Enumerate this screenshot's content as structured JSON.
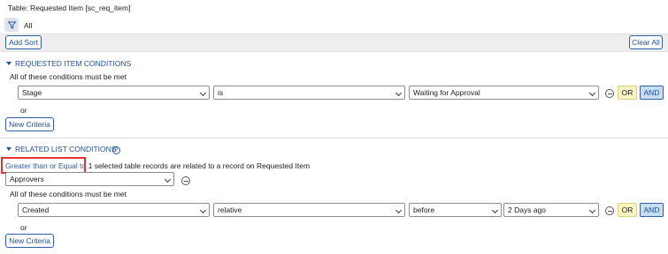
{
  "header": {
    "title": "Table: Requested Item [sc_req_item]",
    "breadcrumb": "All"
  },
  "sortbar": {
    "add_sort": "Add Sort",
    "clear_all": "Clear All"
  },
  "requested_item": {
    "heading": "REQUESTED ITEM CONDITIONS",
    "note": "All of these conditions must be met",
    "condition": {
      "field": "Stage",
      "operator": "is",
      "value": "Waiting for Approval"
    },
    "or_label": "OR",
    "and_label": "AND",
    "or_separator": "or",
    "new_criteria": "New Criteria"
  },
  "related_list": {
    "heading": "RELATED LIST CONDITIONS",
    "help": "?",
    "quantifier_link": "Greater than or Equal to",
    "quantifier_value": "1",
    "sentence": "selected table records are related to a record on Requested Item",
    "list_select": "Approvers",
    "note": "All of these conditions must be met",
    "condition": {
      "field": "Created",
      "operator": "relative",
      "direction": "before",
      "value": "2 Days ago"
    },
    "or_label": "OR",
    "and_label": "AND",
    "or_separator": "or",
    "new_criteria": "New Criteria"
  },
  "colors": {
    "accent": "#1f4f9a",
    "or_bg": "#fbf3c2",
    "and_bg": "#c6ddf4",
    "highlight": "#e8312f"
  }
}
